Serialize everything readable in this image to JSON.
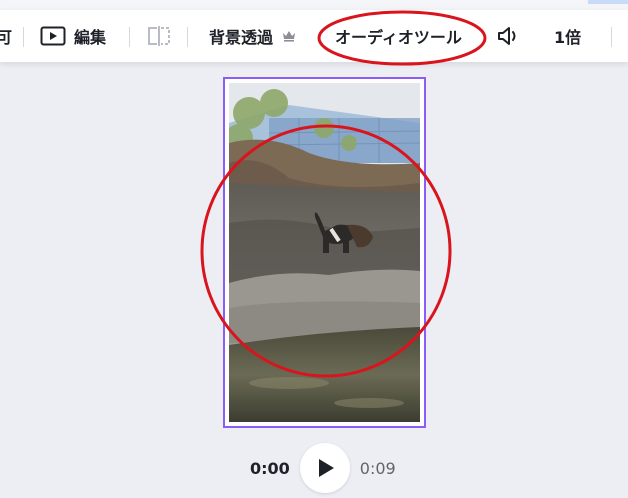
{
  "toolbar": {
    "cut_label": "可",
    "edit_label": "編集",
    "bg_remove_label": "背景透過",
    "audio_tools_label": "オーディオツール",
    "speed_label": "1倍"
  },
  "icons": {
    "edit": "play-square-icon",
    "flip": "flip-split-icon",
    "premium": "crown-icon",
    "volume": "speaker-icon"
  },
  "player": {
    "current_time": "0:00",
    "duration": "0:09"
  },
  "colors": {
    "selection": "#8b5cf6",
    "annotation": "#d9141d"
  }
}
